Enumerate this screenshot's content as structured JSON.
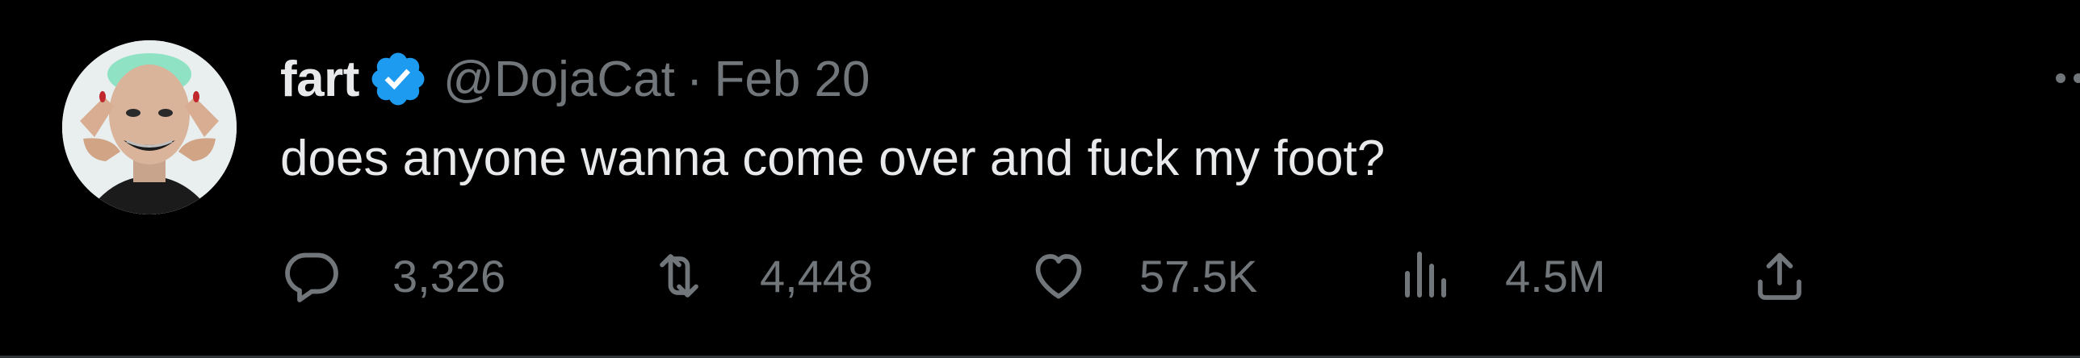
{
  "tweet": {
    "display_name": "fart",
    "verified": true,
    "handle": "@DojaCat",
    "separator": "·",
    "date": "Feb 20",
    "text": "does anyone wanna come over and fuck my foot?",
    "avatar_icon": "profile-photo",
    "more_icon": "more-horizontal-icon"
  },
  "actions": {
    "reply": {
      "icon": "reply-icon",
      "count": "3,326"
    },
    "retweet": {
      "icon": "retweet-icon",
      "count": "4,448"
    },
    "like": {
      "icon": "heart-icon",
      "count": "57.5K"
    },
    "views": {
      "icon": "views-icon",
      "count": "4.5M"
    },
    "share": {
      "icon": "share-icon"
    }
  },
  "colors": {
    "background": "#000000",
    "primary_text": "#e7e9ea",
    "secondary_text": "#71767b",
    "verified_blue": "#1d9bf0",
    "divider": "#2f3336"
  }
}
